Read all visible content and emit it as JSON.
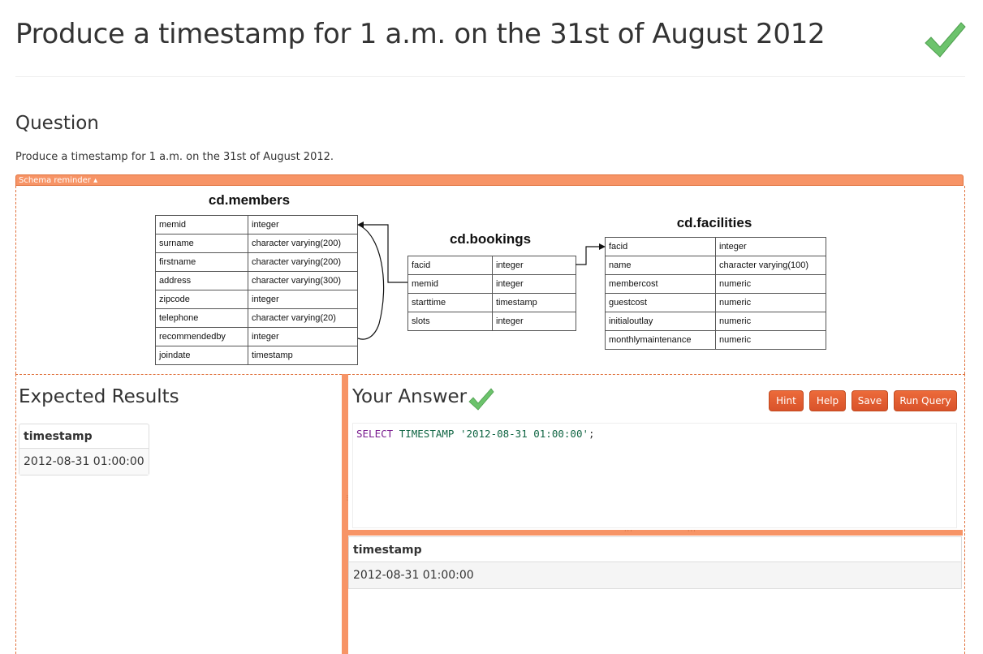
{
  "page": {
    "title": "Produce a timestamp for 1 a.m. on the 31st of August 2012",
    "status_icon": "checkmark-icon",
    "accent_color": "#f79466",
    "check_color": "#5cb85c"
  },
  "question": {
    "heading": "Question",
    "text": "Produce a timestamp for 1 a.m. on the 31st of August 2012."
  },
  "schema": {
    "toggle_label": "Schema reminder ▴",
    "tables": [
      {
        "name": "cd.members",
        "columns": [
          [
            "memid",
            "integer"
          ],
          [
            "surname",
            "character varying(200)"
          ],
          [
            "firstname",
            "character varying(200)"
          ],
          [
            "address",
            "character varying(300)"
          ],
          [
            "zipcode",
            "integer"
          ],
          [
            "telephone",
            "character varying(20)"
          ],
          [
            "recommendedby",
            "integer"
          ],
          [
            "joindate",
            "timestamp"
          ]
        ]
      },
      {
        "name": "cd.bookings",
        "columns": [
          [
            "facid",
            "integer"
          ],
          [
            "memid",
            "integer"
          ],
          [
            "starttime",
            "timestamp"
          ],
          [
            "slots",
            "integer"
          ]
        ]
      },
      {
        "name": "cd.facilities",
        "columns": [
          [
            "facid",
            "integer"
          ],
          [
            "name",
            "character varying(100)"
          ],
          [
            "membercost",
            "numeric"
          ],
          [
            "guestcost",
            "numeric"
          ],
          [
            "initialoutlay",
            "numeric"
          ],
          [
            "monthlymaintenance",
            "numeric"
          ]
        ]
      }
    ]
  },
  "expected": {
    "heading": "Expected Results",
    "column": "timestamp",
    "value": "2012-08-31 01:00:00"
  },
  "answer": {
    "heading": "Your Answer",
    "buttons": {
      "hint": "Hint",
      "help": "Help",
      "save": "Save",
      "run": "Run Query"
    },
    "sql": {
      "select": "SELECT",
      "type": "TIMESTAMP",
      "literal": "'2012-08-31 01:00:00'",
      "end": ";"
    },
    "result_column": "timestamp",
    "result_value": "2012-08-31 01:00:00"
  }
}
